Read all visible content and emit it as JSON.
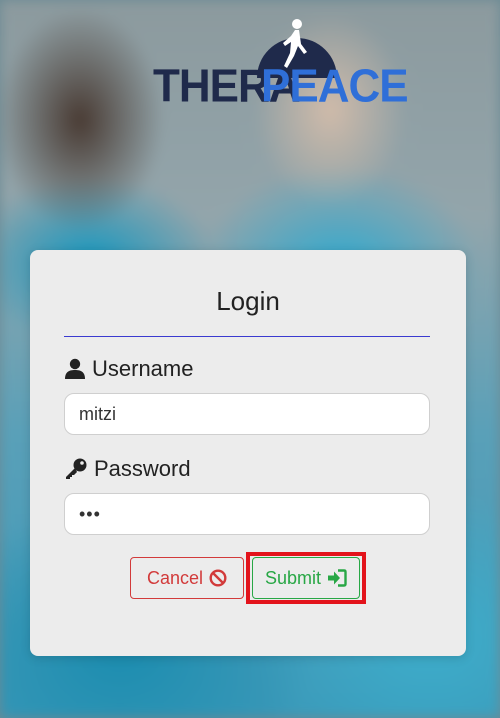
{
  "logo": {
    "text_left": "THERA",
    "text_right": "PEACE",
    "colors": {
      "dark": "#1f2a4b",
      "accent": "#2f6fd8"
    }
  },
  "form": {
    "title": "Login",
    "username": {
      "label": "Username",
      "value": "mitzi",
      "icon": "user-icon"
    },
    "password": {
      "label": "Password",
      "value": "abc",
      "icon": "key-icon"
    },
    "cancel": {
      "label": "Cancel",
      "icon": "ban-icon",
      "color": "#d23a3a"
    },
    "submit": {
      "label": "Submit",
      "icon": "sign-in-icon",
      "color": "#28a745"
    }
  },
  "highlight_color": "#e3131b"
}
